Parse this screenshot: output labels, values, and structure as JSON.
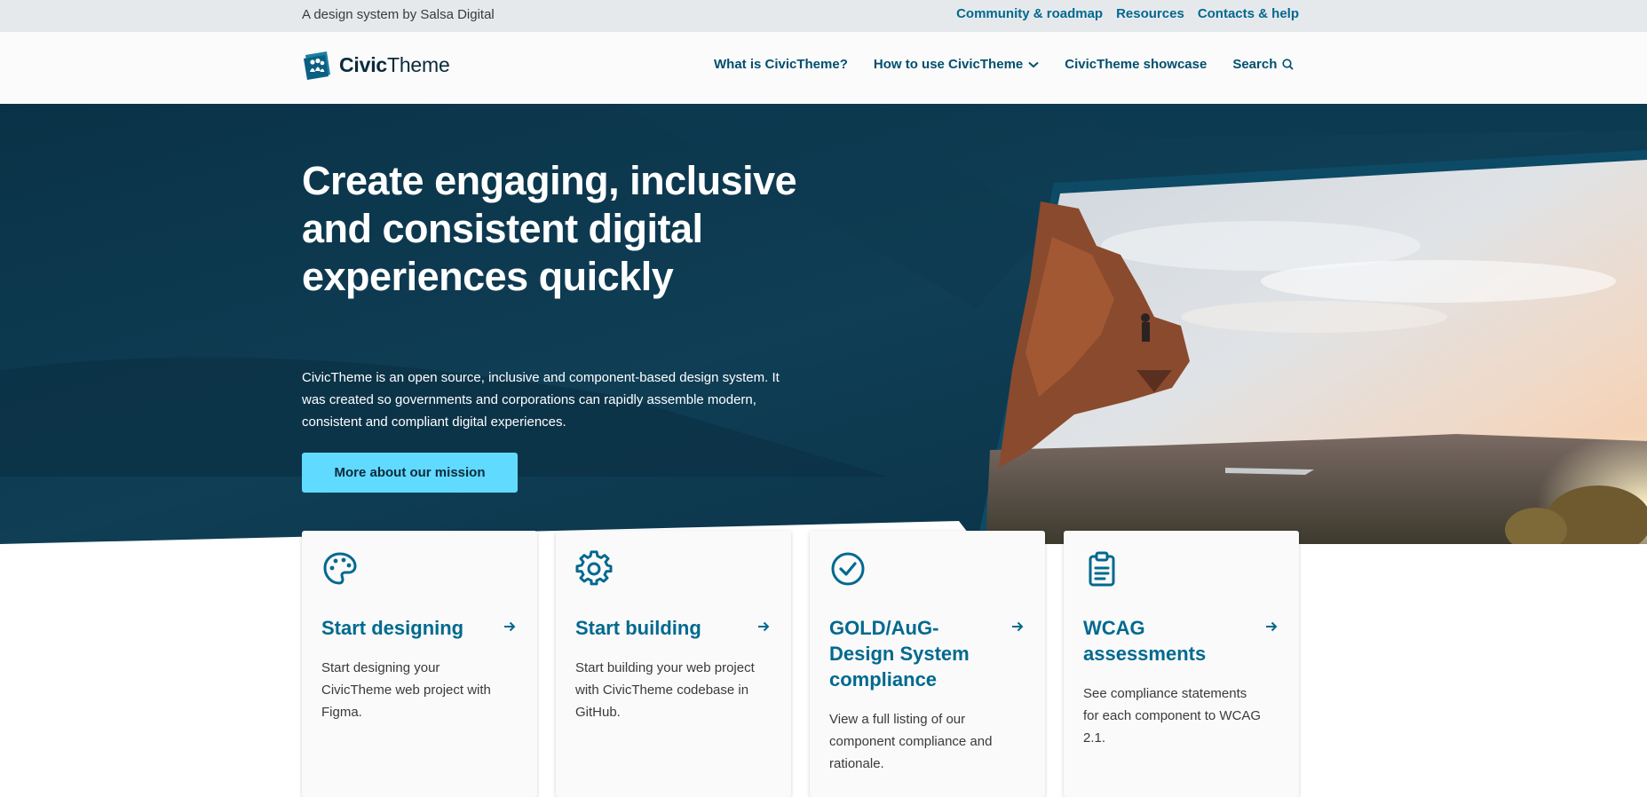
{
  "topbar": {
    "tagline": "A design system by Salsa Digital",
    "links": [
      "Community & roadmap",
      "Resources",
      "Contacts & help"
    ]
  },
  "header": {
    "logo_bold": "Civic",
    "logo_light": "Theme",
    "nav": {
      "what": "What is CivicTheme?",
      "how": "How to use CivicTheme",
      "showcase": "CivicTheme showcase",
      "search": "Search"
    }
  },
  "hero": {
    "title": "Create engaging, inclusive and consistent digital experiences quickly",
    "body": "CivicTheme is an open source, inclusive and component-based design system. It was created so governments and corporations can rapidly assemble modern, consistent and compliant digital experiences.",
    "cta": "More about our mission"
  },
  "cards": [
    {
      "title": "Start designing",
      "text": "Start designing your CivicTheme web project with Figma.",
      "icon": "palette-icon"
    },
    {
      "title": "Start building",
      "text": "Start building your web project with CivicTheme codebase in GitHub.",
      "icon": "gear-icon"
    },
    {
      "title": "GOLD/AuG-Design System compliance",
      "text": "View a full listing of our component compliance and rationale.",
      "icon": "check-circle-icon"
    },
    {
      "title": "WCAG assessments",
      "text": "See compliance statements for each component to WCAG 2.1.",
      "icon": "clipboard-icon"
    }
  ],
  "colors": {
    "brand": "#00698f",
    "hero_dark": "#0c3347",
    "cta": "#61daff",
    "topbar": "#e6e9ec"
  }
}
